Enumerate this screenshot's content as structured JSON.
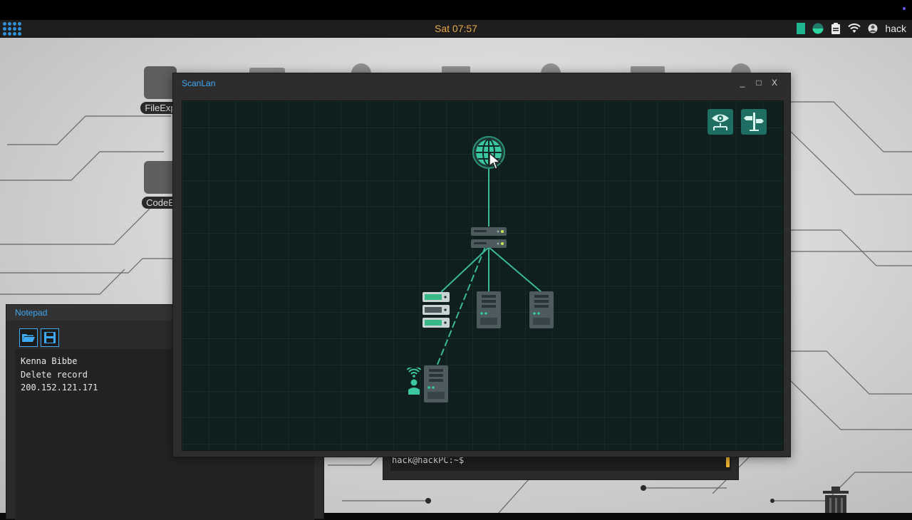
{
  "taskbar": {
    "clock": "Sat 07:57",
    "user": "hack",
    "tray_icons": [
      "note-icon",
      "status-circle-icon",
      "clipboard-icon",
      "wifi-icon",
      "user-icon"
    ]
  },
  "desktop": {
    "icons": [
      {
        "label": "FileExp"
      },
      {
        "label": "CodeE"
      }
    ]
  },
  "notepad": {
    "title": "Notepad",
    "lines": [
      "Kenna Bibbe",
      "Delete record",
      "200.152.121.171"
    ]
  },
  "terminal": {
    "prompt": "hack@hackPC:~$"
  },
  "scanlan": {
    "title": "ScanLan",
    "controls": {
      "minimize": "_",
      "maximize": "□",
      "close": "X"
    },
    "nodes": [
      {
        "type": "internet",
        "icon": "globe-icon"
      },
      {
        "type": "router",
        "icon": "router-icon"
      },
      {
        "type": "server-rack",
        "icon": "server-rack-icon"
      },
      {
        "type": "pc",
        "icon": "pc-tower-icon"
      },
      {
        "type": "pc",
        "icon": "pc-tower-icon"
      },
      {
        "type": "player-pc",
        "icon": "pc-tower-icon",
        "wifi": true,
        "user": true
      }
    ]
  },
  "colors": {
    "accent_blue": "#3fa9f5",
    "clock": "#e6a84a",
    "network_line": "#3bb89a",
    "grid_bg": "#0f1f1d",
    "tool_button": "#1f6e63"
  }
}
